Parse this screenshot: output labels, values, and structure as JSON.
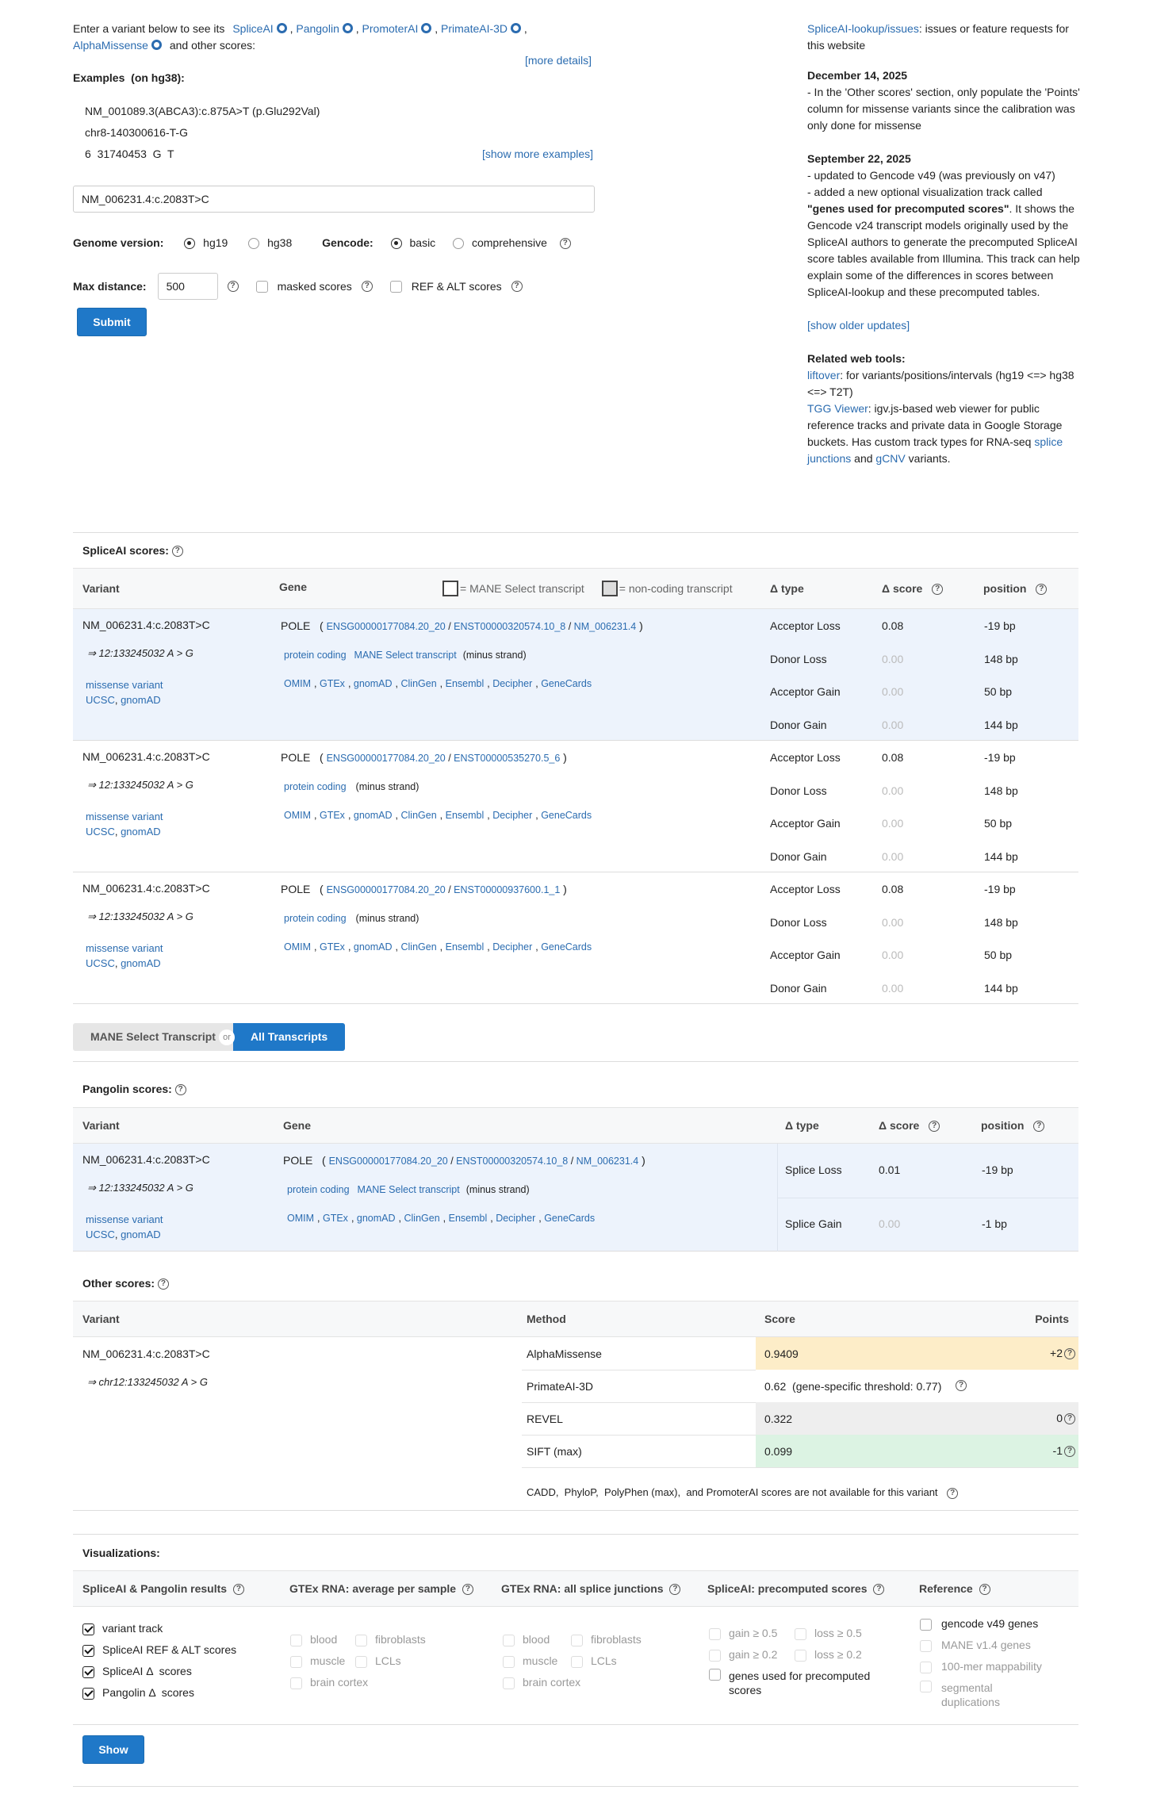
{
  "intro": {
    "prefix": "Enter a variant below to see its",
    "tools": [
      "SpliceAI",
      "Pangolin",
      "PromoterAI",
      "PrimateAI-3D",
      "AlphaMissense"
    ],
    "suffix": "and other scores:",
    "more_details": "[more details]"
  },
  "examples": {
    "title": "Examples",
    "build": "(on hg38):",
    "items": [
      "NM_001089.3(ABCA3):c.875A>T (p.Glu292Val)",
      "chr8-140300616-T-G",
      "6  31740453  G  T"
    ],
    "show_more": "[show more examples]"
  },
  "search": {
    "value": "NM_006231.4:c.2083T>C"
  },
  "options": {
    "genome_label": "Genome version:",
    "genome_options": [
      "hg19",
      "hg38"
    ],
    "gencode_label": "Gencode:",
    "gencode_options": [
      "basic",
      "comprehensive"
    ],
    "max_distance_label": "Max distance:",
    "max_distance_value": "500",
    "masked_label": "masked scores",
    "refalt_label": "REF & ALT scores",
    "submit": "Submit"
  },
  "news": {
    "issues_link": "SpliceAI-lookup/issues",
    "issues_text": ": issues or feature requests for this website",
    "u1_date": "December 14, 2025",
    "u1_text": "- In the 'Other scores' section, only populate the 'Points' column for missense variants since the calibration was only done for missense",
    "u2_date": "September 22, 2025",
    "u2_line1": "- updated to Gencode v49 (was previously on v47)",
    "u2_line2_a": "- added a new optional visualization track called",
    "u2_line2_b": "\"genes used for precomputed scores\"",
    "u2_line2_c": ". It shows the Gencode v24 transcript models originally used by the SpliceAI authors to generate the precomputed SpliceAI score tables available from Illumina. This track can help explain some of the differences in scores between SpliceAI-lookup and these precomputed tables.",
    "older": "[show older updates]",
    "related_title": "Related web tools:",
    "liftover": "liftover",
    "liftover_text": ": for variants/positions/intervals (hg19 <=> hg38 <=> T2T)",
    "tgg": "TGG Viewer",
    "tgg_text": ": igv.js-based web viewer for public reference tracks and private data in Google Storage buckets. Has custom track types for RNA-seq",
    "splice_junctions": "splice junctions",
    "and": "and",
    "gcnv": "gCNV",
    "variants": "variants."
  },
  "spliceai": {
    "title": "SpliceAI scores:",
    "headers": {
      "variant": "Variant",
      "gene": "Gene",
      "mane": "= MANE Select transcript",
      "noncoding": "= non-coding transcript",
      "type": "Δ type",
      "score": "Δ score",
      "position": "position"
    },
    "rows": [
      {
        "variant": "NM_006231.4:c.2083T>C",
        "genomic": "⇒ 12:133245032 A > G",
        "consequence": "missense variant",
        "ucsc": "UCSC",
        "gnomad": "gnomAD",
        "gene": "POLE",
        "ensg": "ENSG00000177084.20_20",
        "enst": "ENST00000320574.10_8",
        "refseq": "NM_006231.4",
        "biotype": "protein coding",
        "mane": "MANE Select transcript",
        "strand": "(minus strand)",
        "links": [
          "OMIM",
          "GTEx",
          "gnomAD",
          "ClinGen",
          "Ensembl",
          "Decipher",
          "GeneCards"
        ],
        "scores": [
          {
            "type": "Acceptor Loss",
            "score": "0.08",
            "pos": "-19 bp"
          },
          {
            "type": "Donor Loss",
            "score": "0.00",
            "pos": "148 bp"
          },
          {
            "type": "Acceptor Gain",
            "score": "0.00",
            "pos": "50 bp"
          },
          {
            "type": "Donor Gain",
            "score": "0.00",
            "pos": "144 bp"
          }
        ]
      },
      {
        "variant": "NM_006231.4:c.2083T>C",
        "genomic": "⇒ 12:133245032 A > G",
        "consequence": "missense variant",
        "ucsc": "UCSC",
        "gnomad": "gnomAD",
        "gene": "POLE",
        "ensg": "ENSG00000177084.20_20",
        "enst": "ENST00000535270.5_6",
        "refseq": "",
        "biotype": "protein coding",
        "mane": "",
        "strand": "(minus strand)",
        "links": [
          "OMIM",
          "GTEx",
          "gnomAD",
          "ClinGen",
          "Ensembl",
          "Decipher",
          "GeneCards"
        ],
        "scores": [
          {
            "type": "Acceptor Loss",
            "score": "0.08",
            "pos": "-19 bp"
          },
          {
            "type": "Donor Loss",
            "score": "0.00",
            "pos": "148 bp"
          },
          {
            "type": "Acceptor Gain",
            "score": "0.00",
            "pos": "50 bp"
          },
          {
            "type": "Donor Gain",
            "score": "0.00",
            "pos": "144 bp"
          }
        ]
      },
      {
        "variant": "NM_006231.4:c.2083T>C",
        "genomic": "⇒ 12:133245032 A > G",
        "consequence": "missense variant",
        "ucsc": "UCSC",
        "gnomad": "gnomAD",
        "gene": "POLE",
        "ensg": "ENSG00000177084.20_20",
        "enst": "ENST00000937600.1_1",
        "refseq": "",
        "biotype": "protein coding",
        "mane": "",
        "strand": "(minus strand)",
        "links": [
          "OMIM",
          "GTEx",
          "gnomAD",
          "ClinGen",
          "Ensembl",
          "Decipher",
          "GeneCards"
        ],
        "scores": [
          {
            "type": "Acceptor Loss",
            "score": "0.08",
            "pos": "-19 bp"
          },
          {
            "type": "Donor Loss",
            "score": "0.00",
            "pos": "148 bp"
          },
          {
            "type": "Acceptor Gain",
            "score": "0.00",
            "pos": "50 bp"
          },
          {
            "type": "Donor Gain",
            "score": "0.00",
            "pos": "144 bp"
          }
        ]
      }
    ]
  },
  "toggle": {
    "left": "MANE Select Transcript",
    "or": "or",
    "right": "All Transcripts"
  },
  "pangolin": {
    "title": "Pangolin scores:",
    "headers": {
      "variant": "Variant",
      "gene": "Gene",
      "type": "Δ type",
      "score": "Δ score",
      "position": "position"
    },
    "row": {
      "variant": "NM_006231.4:c.2083T>C",
      "genomic": "⇒ 12:133245032 A > G",
      "consequence": "missense variant",
      "ucsc": "UCSC",
      "gnomad": "gnomAD",
      "gene": "POLE",
      "ensg": "ENSG00000177084.20_20",
      "enst": "ENST00000320574.10_8",
      "refseq": "NM_006231.4",
      "biotype": "protein coding",
      "mane": "MANE Select transcript",
      "strand": "(minus strand)",
      "links": [
        "OMIM",
        "GTEx",
        "gnomAD",
        "ClinGen",
        "Ensembl",
        "Decipher",
        "GeneCards"
      ],
      "scores": [
        {
          "type": "Splice Loss",
          "score": "0.01",
          "pos": "-19 bp"
        },
        {
          "type": "Splice Gain",
          "score": "0.00",
          "pos": "-1 bp"
        }
      ]
    }
  },
  "other": {
    "title": "Other scores:",
    "headers": {
      "variant": "Variant",
      "method": "Method",
      "score": "Score",
      "points": "Points"
    },
    "variant": "NM_006231.4:c.2083T>C",
    "genomic": "⇒ chr12:133245032 A > G",
    "rows": [
      {
        "method": "AlphaMissense",
        "score": "0.9409",
        "points": "+2",
        "bg": "#fdedc8"
      },
      {
        "method": "PrimateAI-3D",
        "score": "0.62  (gene-specific threshold: 0.77)",
        "points": "",
        "bg": "#ffffff"
      },
      {
        "method": "REVEL",
        "score": "0.322",
        "points": "0",
        "bg": "#eeeeee"
      },
      {
        "method": "SIFT (max)",
        "score": "0.099",
        "points": "-1",
        "bg": "#dcf3e3"
      }
    ],
    "note": "CADD,  PhyloP,  PolyPhen (max),  and PromoterAI scores are not available for this variant"
  },
  "vis": {
    "title": "Visualizations:",
    "col1_title": "SpliceAI & Pangolin results",
    "col1": [
      "variant track",
      "SpliceAI REF & ALT scores",
      "SpliceAI Δ  scores",
      "Pangolin Δ  scores"
    ],
    "col2_title": "GTEx RNA: average per sample",
    "col3_title": "GTEx RNA: all splice junctions",
    "tissues": [
      "blood",
      "fibroblasts",
      "muscle",
      "LCLs",
      "brain cortex"
    ],
    "col4_title": "SpliceAI: precomputed scores",
    "col4": [
      "gain ≥ 0.5",
      "loss ≥ 0.5",
      "gain ≥ 0.2",
      "loss ≥ 0.2"
    ],
    "col4_genes": "genes used for precomputed scores",
    "col5_title": "Reference",
    "col5": [
      "gencode v49 genes",
      "MANE v1.4 genes",
      "100-mer mappability",
      "segmental duplications"
    ],
    "show": "Show"
  }
}
